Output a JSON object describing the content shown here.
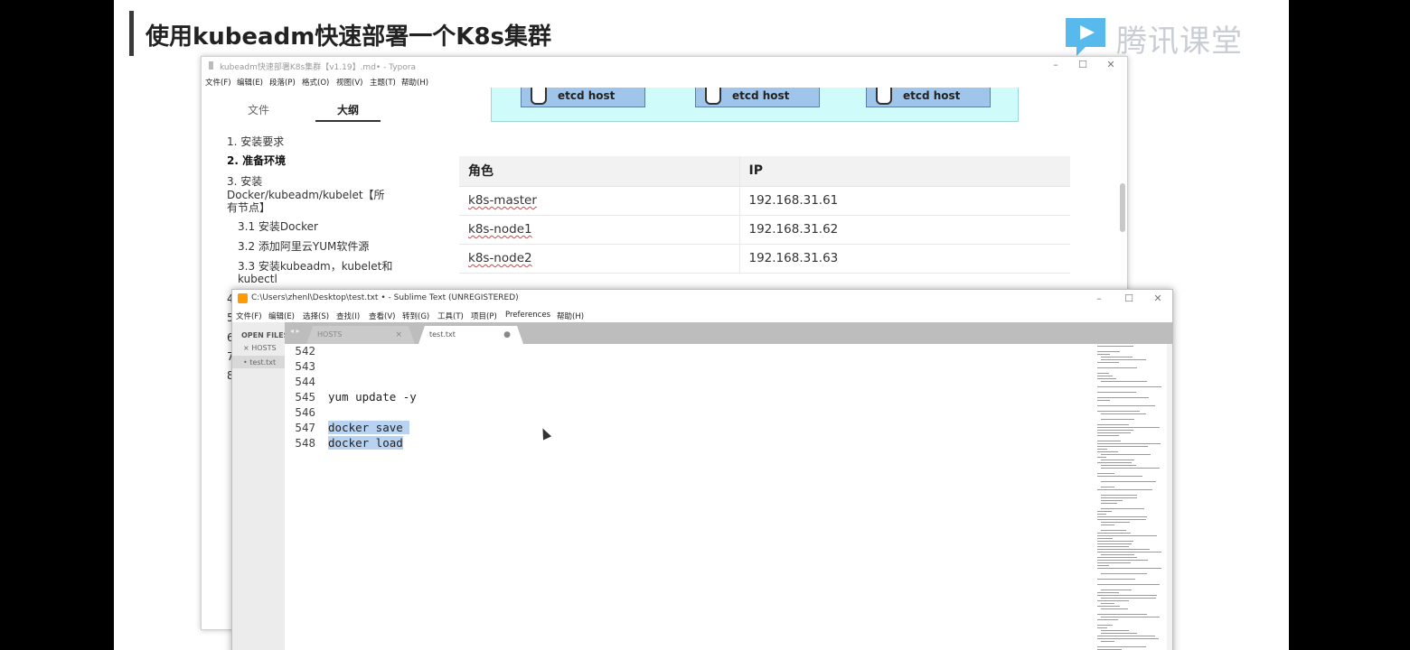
{
  "slide": {
    "title": "使用kubeadm快速部署一个K8s集群",
    "brand": "腾讯课堂"
  },
  "typora": {
    "title": "kubeadm快速部署K8s集群【v1.19】.md• - Typora",
    "menu": [
      "文件(F)",
      "编辑(E)",
      "段落(P)",
      "格式(O)",
      "视图(V)",
      "主题(T)",
      "帮助(H)"
    ],
    "tabs": [
      "文件",
      "大纲"
    ],
    "outline": [
      "1. 安装要求",
      "2. 准备环境",
      "3. 安装",
      "Docker/kubeadm/kubelet【所",
      "有节点】",
      "3.1 安装Docker",
      "3.2 添加阿里云YUM软件源",
      "3.3 安装kubeadm，kubelet和",
      "kubectl"
    ],
    "outline_hidden_numbers": [
      "4",
      "5",
      "6",
      "7",
      "8"
    ],
    "diagram": {
      "boxes": [
        "etcd host",
        "etcd host",
        "etcd host"
      ]
    },
    "table": {
      "headers": [
        "角色",
        "IP"
      ],
      "rows": [
        [
          "k8s-master",
          "192.168.31.61"
        ],
        [
          "k8s-node1",
          "192.168.31.62"
        ],
        [
          "k8s-node2",
          "192.168.31.63"
        ]
      ]
    }
  },
  "sublime": {
    "title": "C:\\Users\\zhenl\\Desktop\\test.txt • - Sublime Text (UNREGISTERED)",
    "menu": [
      "文件(F)",
      "编辑(E)",
      "选择(S)",
      "查找(I)",
      "查看(V)",
      "转到(G)",
      "工具(T)",
      "项目(P)",
      "Preferences",
      "帮助(H)"
    ],
    "sidebar": {
      "heading": "OPEN FILES",
      "files": [
        "× HOSTS",
        "• test.txt"
      ]
    },
    "tabs": [
      {
        "label": "HOSTS",
        "close": "×"
      },
      {
        "label": "test.txt",
        "close": "●"
      }
    ],
    "nav": "◂ ▸",
    "lines": [
      {
        "num": "542",
        "text": ""
      },
      {
        "num": "543",
        "text": ""
      },
      {
        "num": "544",
        "text": ""
      },
      {
        "num": "545",
        "text": "yum update -y"
      },
      {
        "num": "546",
        "text": ""
      },
      {
        "num": "547",
        "text": "docker save "
      },
      {
        "num": "548",
        "text": "docker load"
      }
    ]
  }
}
